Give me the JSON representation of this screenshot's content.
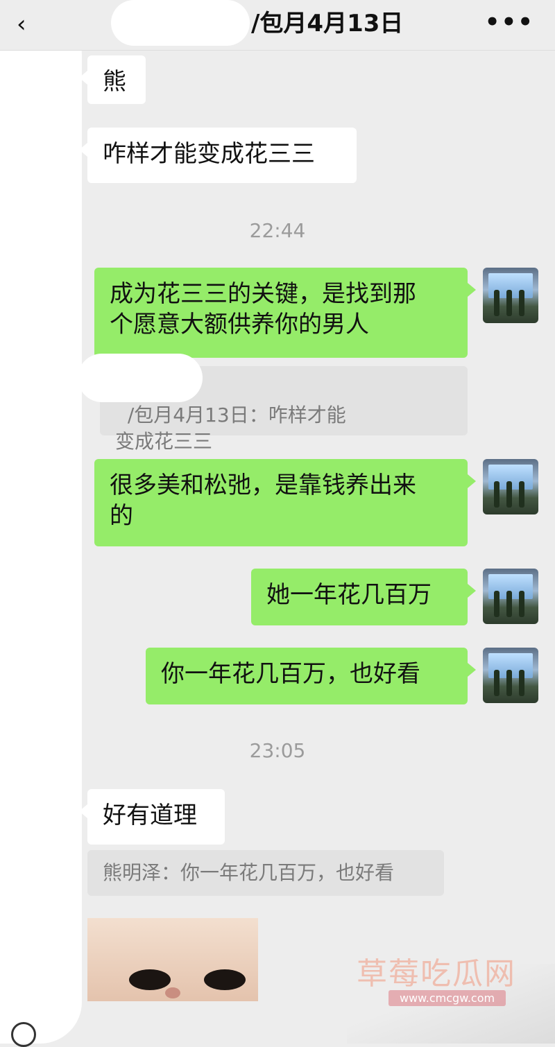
{
  "header": {
    "title": "/包月4月13日",
    "back_icon": "‹",
    "more_icon": "•••"
  },
  "messages": {
    "m1": "熊",
    "m2": "咋样才能变成花三三",
    "time1": "22:44",
    "m3": "成为花三三的关键，是找到那\n个愿意大额供养你的男人",
    "q1": "/包月4月13日：咋样才能\n变成花三三",
    "m4": "很多美和松弛，是靠钱养出来\n的",
    "m5": "她一年花几百万",
    "m6": "你一年花几百万，也好看",
    "time2": "23:05",
    "m7": "好有道理",
    "q2": "熊明泽：你一年花几百万，也好看"
  },
  "watermark": {
    "title": "草莓吃瓜网",
    "url": "www.cmcgw.com"
  },
  "colors": {
    "background": "#ededed",
    "outgoing_bubble": "#95ec69",
    "incoming_bubble": "#ffffff"
  }
}
